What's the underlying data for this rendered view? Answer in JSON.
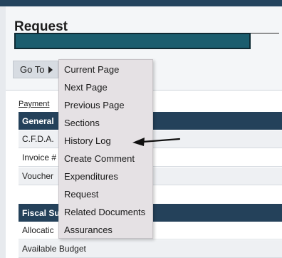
{
  "page": {
    "title": "Request",
    "payment_link": "Payment"
  },
  "goto": {
    "label": "Go To"
  },
  "menu": {
    "items": [
      {
        "label": "Current Page"
      },
      {
        "label": "Next Page"
      },
      {
        "label": "Previous Page"
      },
      {
        "label": "Sections"
      },
      {
        "label": "History Log"
      },
      {
        "label": "Create Comment"
      },
      {
        "label": "Expenditures"
      },
      {
        "label": "Request"
      },
      {
        "label": "Related Documents"
      },
      {
        "label": "Assurances"
      }
    ]
  },
  "general_section": {
    "header": "General",
    "rows": [
      {
        "label": "C.F.D.A."
      },
      {
        "label": "Invoice #"
      },
      {
        "label": "Voucher"
      }
    ]
  },
  "fiscal_section": {
    "header": "Fiscal Su",
    "rows": [
      {
        "label": "Allocatic"
      },
      {
        "label": "Available Budget"
      }
    ]
  },
  "colors": {
    "section_header_bg": "#24415a",
    "menu_bg": "#e5e1e4",
    "redaction_fill": "#1b5d6e"
  }
}
